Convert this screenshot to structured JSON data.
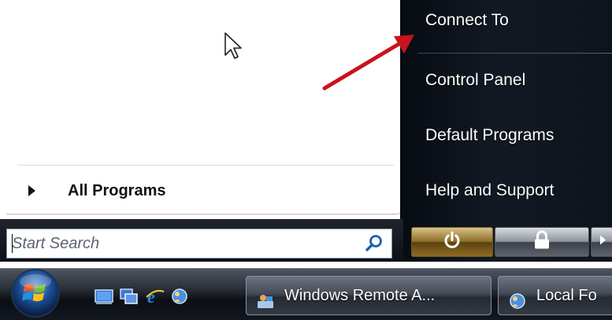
{
  "start_menu": {
    "all_programs": {
      "label": "All Programs"
    },
    "right_pane": {
      "items": [
        {
          "label": "Connect To"
        },
        {
          "label": "Control Panel"
        },
        {
          "label": "Default Programs"
        },
        {
          "label": "Help and Support"
        }
      ]
    },
    "search": {
      "placeholder": "Start Search",
      "value": "",
      "button_icon": "search-magnifier-icon"
    },
    "power": {
      "power_icon": "power-icon",
      "lock_icon": "lock-icon",
      "arrow_icon": "chevron-right-icon"
    }
  },
  "taskbar": {
    "start_icon": "windows-start-orb-icon",
    "quick_launch": [
      {
        "icon": "show-desktop-icon"
      },
      {
        "icon": "switch-windows-icon"
      },
      {
        "icon": "internet-explorer-icon"
      },
      {
        "icon": "remote-assistance-icon"
      }
    ],
    "buttons": [
      {
        "label": "Windows Remote A...",
        "icon": "remote-assistance-icon"
      },
      {
        "label": "Local Fo",
        "icon": "local-folder-icon"
      }
    ]
  },
  "colors": {
    "annotation_arrow": "#c8141c",
    "right_pane_bg": "#0e141c",
    "power_button": "#8e6e2a"
  }
}
